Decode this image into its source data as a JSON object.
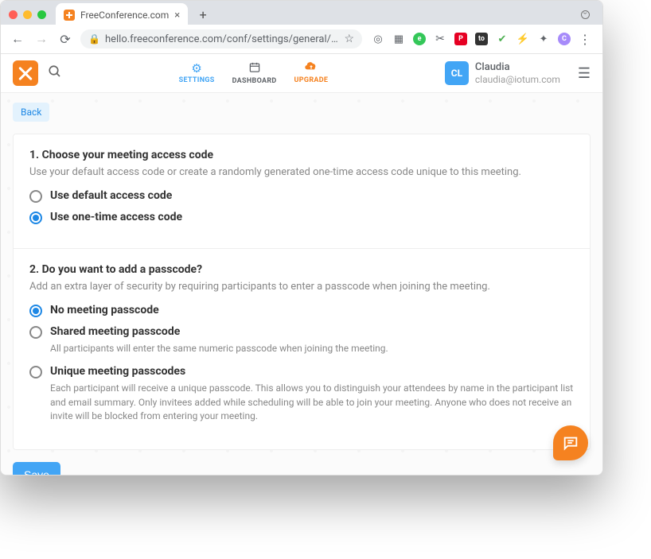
{
  "browser": {
    "tab_title": "FreeConference.com",
    "url_display": "hello.freeconference.com/conf/settings/general/securit..."
  },
  "header": {
    "nav": {
      "settings": "SETTINGS",
      "dashboard": "DASHBOARD",
      "upgrade": "UPGRADE"
    },
    "user": {
      "initials": "CL",
      "name": "Claudia",
      "email": "claudia@iotum.com"
    }
  },
  "page": {
    "back": "Back",
    "section1": {
      "title": "1. Choose your meeting access code",
      "desc": "Use your default access code or create a randomly generated one-time access code unique to this meeting.",
      "opt1": "Use default access code",
      "opt2": "Use one-time access code"
    },
    "section2": {
      "title": "2. Do you want to add a passcode?",
      "desc": "Add an extra layer of security by requiring participants to enter a passcode when joining the meeting.",
      "opt1": "No meeting passcode",
      "opt2": "Shared meeting passcode",
      "opt2_sub": "All participants will enter the same numeric passcode when joining the meeting.",
      "opt3": "Unique meeting passcodes",
      "opt3_sub": "Each participant will receive a unique passcode. This allows you to distinguish your attendees by name in the participant list and email summary. Only invitees added while scheduling will be able to join your meeting. Anyone who does not receive an invite will be blocked from entering your meeting."
    },
    "save": "Save"
  }
}
